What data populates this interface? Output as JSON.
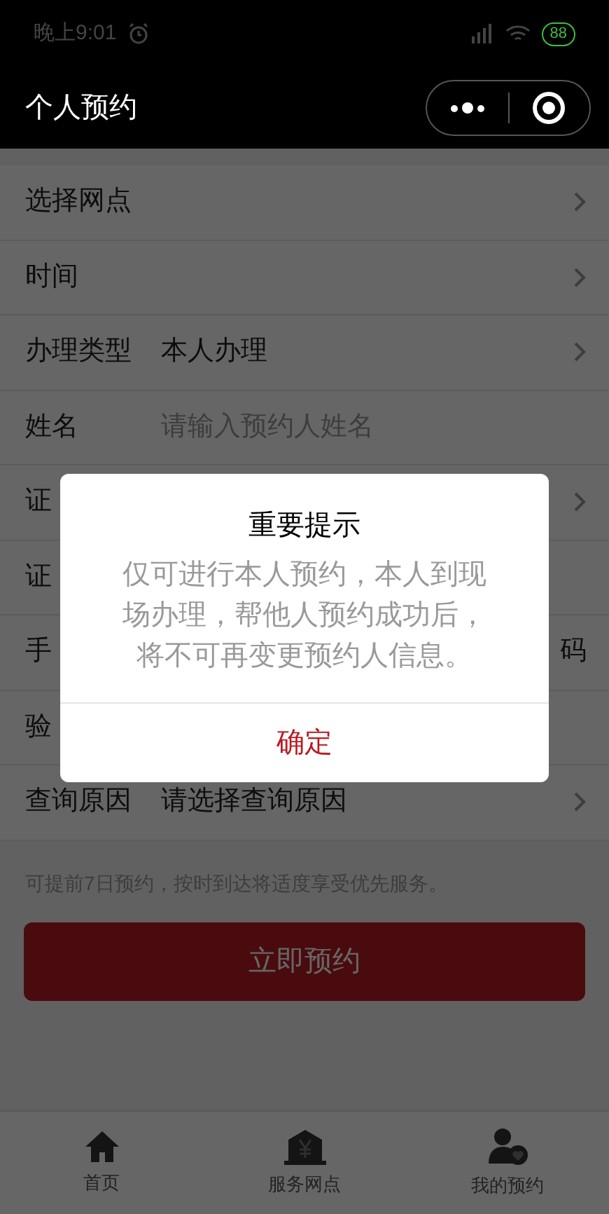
{
  "status_bar": {
    "time": "晚上9:01",
    "battery": "88"
  },
  "title_bar": {
    "title": "个人预约"
  },
  "form_rows": [
    {
      "label": "选择网点",
      "chevron": true
    },
    {
      "label": "时间",
      "chevron": true
    },
    {
      "label": "办理类型",
      "value": "本人办理",
      "chevron": true
    },
    {
      "label": "姓名",
      "placeholder": "请输入预约人姓名",
      "chevron": false
    },
    {
      "label": "证",
      "chevron": true
    },
    {
      "label": "证",
      "chevron": false
    },
    {
      "label": "手",
      "action": "码",
      "chevron": false
    },
    {
      "label": "验",
      "chevron": false
    },
    {
      "label": "查询原因",
      "value": "请选择查询原因",
      "chevron": true
    }
  ],
  "hint": "可提前7日预约，按时到达将适度享受优先服务。",
  "submit_button": "立即预约",
  "dialog": {
    "title": "重要提示",
    "message": "仅可进行本人预约，本人到现场办理，帮他人预约成功后，将不可再变更预约人信息。",
    "confirm": "确定"
  },
  "tab_bar": [
    {
      "kind": "home",
      "label": "首页",
      "selected": false
    },
    {
      "kind": "bank",
      "label": "服务网点",
      "selected": false
    },
    {
      "kind": "profile",
      "label": "我的预约",
      "selected": false
    }
  ]
}
